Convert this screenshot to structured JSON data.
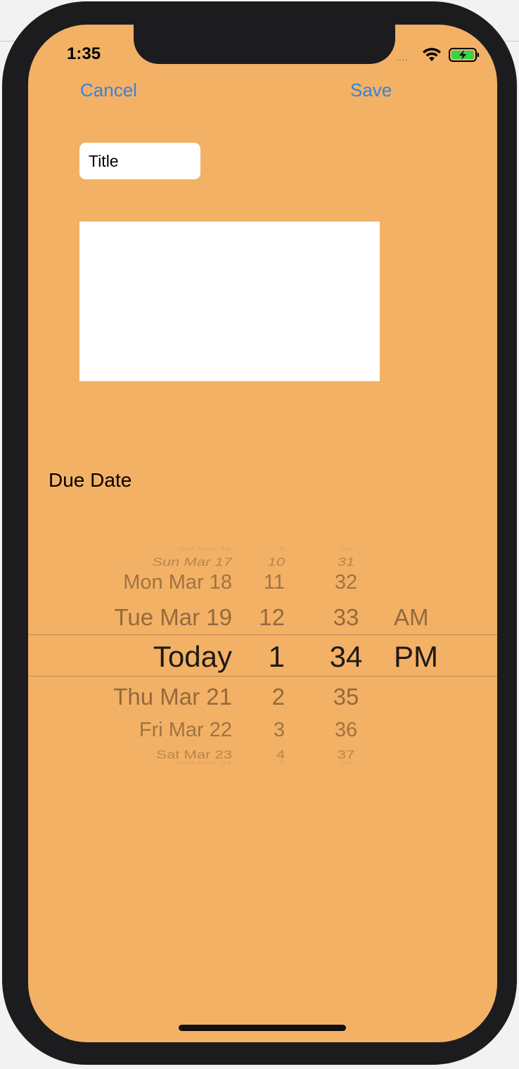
{
  "status_bar": {
    "time": "1:35",
    "signal": "....",
    "wifi_icon": "wifi-icon",
    "battery_icon": "battery-charging-icon",
    "battery_color": "#3ad14a"
  },
  "nav": {
    "cancel_label": "Cancel",
    "save_label": "Save",
    "accent_color": "#3a82d6"
  },
  "form": {
    "title_placeholder": "Title",
    "notes_value": "",
    "due_date_label": "Due Date"
  },
  "date_picker": {
    "dates": [
      "Sat Mar 16",
      "Sun Mar 17",
      "Mon Mar 18",
      "Tue Mar 19",
      "Today",
      "Thu Mar 21",
      "Fri Mar 22",
      "Sat Mar 23",
      "Sun Mar 24"
    ],
    "hours": [
      "9",
      "10",
      "11",
      "12",
      "1",
      "2",
      "3",
      "4",
      "5"
    ],
    "minutes": [
      "30",
      "31",
      "32",
      "33",
      "34",
      "35",
      "36",
      "37",
      "38"
    ],
    "ampm": [
      "AM",
      "PM"
    ],
    "selected": {
      "date": "Today",
      "hour": "1",
      "minute": "34",
      "ampm": "PM"
    }
  },
  "theme": {
    "background": "#f3b166",
    "frame": "#1c1c1e"
  }
}
